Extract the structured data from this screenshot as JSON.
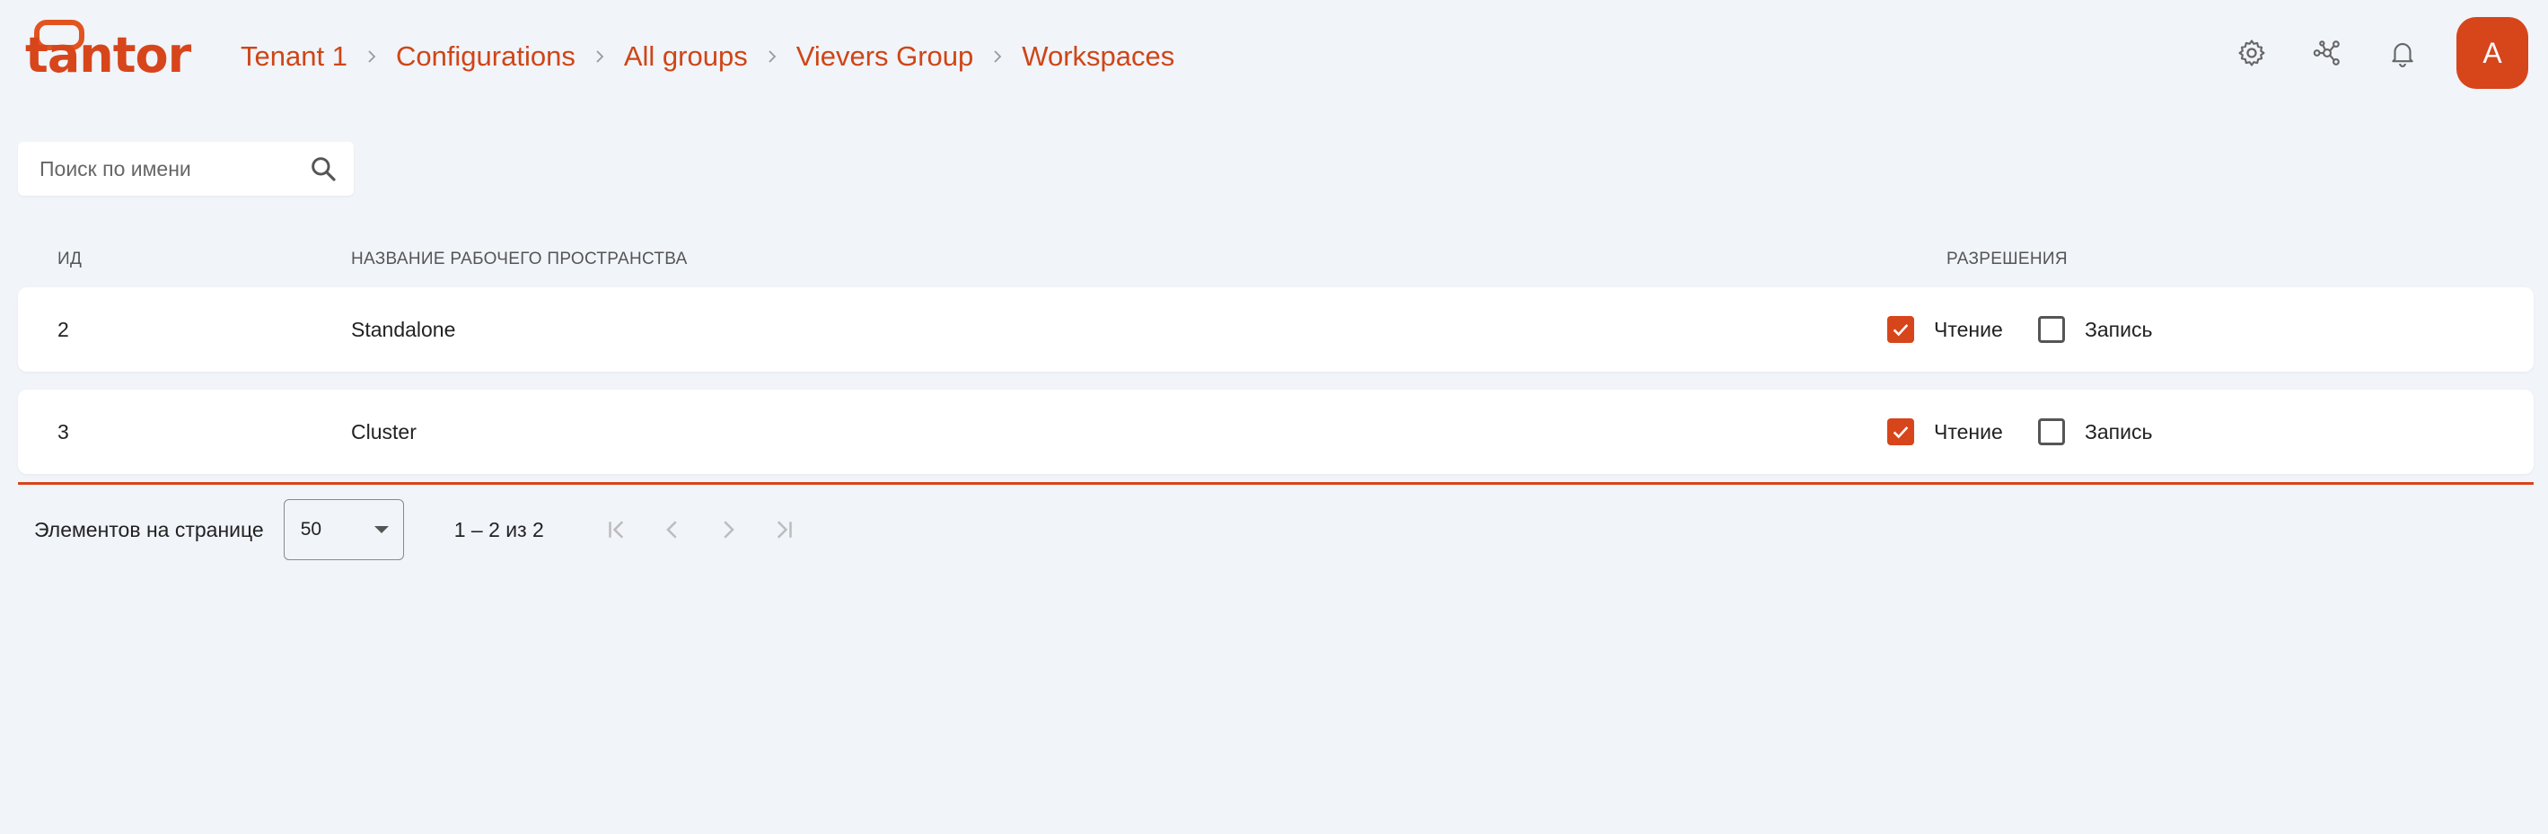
{
  "brand": {
    "logo_text": "tantor",
    "accent": "#d7451b"
  },
  "breadcrumb": [
    "Tenant 1",
    "Configurations",
    "All groups",
    "Vievers Group",
    "Workspaces"
  ],
  "header_icons": [
    "gear-icon",
    "network-icon",
    "bell-icon"
  ],
  "user": {
    "avatar_initial": "A"
  },
  "search": {
    "placeholder": "Поиск по имени",
    "value": ""
  },
  "table": {
    "headers": {
      "id": "ИД",
      "name": "НАЗВАНИЕ РАБОЧЕГО ПРОСТРАНСТВА",
      "permissions": "РАЗРЕШЕНИЯ"
    },
    "rows": [
      {
        "id": "2",
        "name": "Standalone",
        "read_label": "Чтение",
        "read": true,
        "write_label": "Запись",
        "write": false
      },
      {
        "id": "3",
        "name": "Cluster",
        "read_label": "Чтение",
        "read": true,
        "write_label": "Запись",
        "write": false
      }
    ]
  },
  "pagination": {
    "items_per_page_label": "Элементов на странице",
    "page_size": "50",
    "range": "1 – 2 из 2"
  }
}
